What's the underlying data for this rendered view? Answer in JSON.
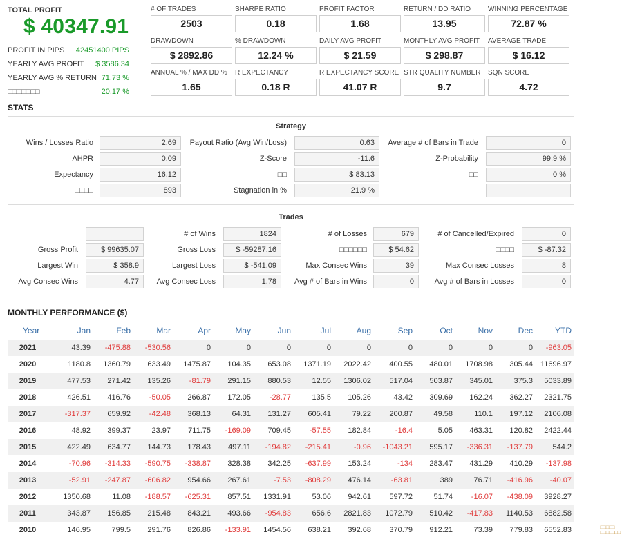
{
  "summary": {
    "title": "TOTAL PROFIT",
    "total_value": "$ 40347.91",
    "rows": [
      {
        "label": "PROFIT IN PIPS",
        "value": "42451400 PIPS"
      },
      {
        "label": "YEARLY AVG PROFIT",
        "value": "$ 3586.34"
      },
      {
        "label": "YEARLY AVG % RETURN",
        "value": "71.73 %"
      },
      {
        "label": "□□□□□□□",
        "value": "20.17 %"
      }
    ]
  },
  "metrics": [
    {
      "label": "# OF TRADES",
      "value": "2503"
    },
    {
      "label": "SHARPE RATIO",
      "value": "0.18"
    },
    {
      "label": "PROFIT FACTOR",
      "value": "1.68"
    },
    {
      "label": "RETURN / DD RATIO",
      "value": "13.95"
    },
    {
      "label": "WINNING PERCENTAGE",
      "value": "72.87 %"
    },
    {
      "label": "DRAWDOWN",
      "value": "$ 2892.86"
    },
    {
      "label": "% DRAWDOWN",
      "value": "12.24 %"
    },
    {
      "label": "DAILY AVG PROFIT",
      "value": "$ 21.59"
    },
    {
      "label": "MONTHLY AVG PROFIT",
      "value": "$ 298.87"
    },
    {
      "label": "AVERAGE TRADE",
      "value": "$ 16.12"
    },
    {
      "label": "ANNUAL % / MAX DD %",
      "value": "1.65"
    },
    {
      "label": "R EXPECTANCY",
      "value": "0.18 R"
    },
    {
      "label": "R EXPECTANCY SCORE",
      "value": "41.07 R"
    },
    {
      "label": "STR QUALITY NUMBER",
      "value": "9.7"
    },
    {
      "label": "SQN SCORE",
      "value": "4.72"
    }
  ],
  "stats": {
    "title": "STATS",
    "strategy_heading": "Strategy",
    "strategy": [
      [
        {
          "label": "Wins / Losses Ratio",
          "value": "2.69"
        },
        {
          "label": "Payout Ratio (Avg Win/Loss)",
          "value": "0.63"
        },
        {
          "label": "Average # of Bars in Trade",
          "value": "0"
        }
      ],
      [
        {
          "label": "AHPR",
          "value": "0.09"
        },
        {
          "label": "Z-Score",
          "value": "-11.6"
        },
        {
          "label": "Z-Probability",
          "value": "99.9 %"
        }
      ],
      [
        {
          "label": "Expectancy",
          "value": "16.12"
        },
        {
          "label": "□□",
          "value": "$ 83.13"
        },
        {
          "label": "□□",
          "value": "0 %"
        }
      ],
      [
        {
          "label": "□□□□",
          "value": "893"
        },
        {
          "label": "Stagnation in %",
          "value": "21.9 %"
        },
        {
          "label": "",
          "value": ""
        }
      ]
    ],
    "trades_heading": "Trades",
    "trades": [
      [
        {
          "label": "",
          "value": ""
        },
        {
          "label": "# of Wins",
          "value": "1824"
        },
        {
          "label": "# of Losses",
          "value": "679"
        },
        {
          "label": "# of Cancelled/Expired",
          "value": "0"
        }
      ],
      [
        {
          "label": "Gross Profit",
          "value": "$ 99635.07"
        },
        {
          "label": "Gross Loss",
          "value": "$ -59287.16"
        },
        {
          "label": "□□□□□□",
          "value": "$ 54.62"
        },
        {
          "label": "□□□□",
          "value": "$ -87.32"
        }
      ],
      [
        {
          "label": "Largest Win",
          "value": "$ 358.9"
        },
        {
          "label": "Largest Loss",
          "value": "$ -541.09"
        },
        {
          "label": "Max Consec Wins",
          "value": "39"
        },
        {
          "label": "Max Consec Losses",
          "value": "8"
        }
      ],
      [
        {
          "label": "Avg Consec Wins",
          "value": "4.77"
        },
        {
          "label": "Avg Consec Loss",
          "value": "1.78"
        },
        {
          "label": "Avg # of Bars in Wins",
          "value": "0"
        },
        {
          "label": "Avg # of Bars in Losses",
          "value": "0"
        }
      ]
    ]
  },
  "monthly": {
    "title": "MONTHLY PERFORMANCE ($)",
    "headers": [
      "Year",
      "Jan",
      "Feb",
      "Mar",
      "Apr",
      "May",
      "Jun",
      "Jul",
      "Aug",
      "Sep",
      "Oct",
      "Nov",
      "Dec",
      "YTD"
    ],
    "rows": [
      [
        "2021",
        "43.39",
        "-475.88",
        "-530.56",
        "0",
        "0",
        "0",
        "0",
        "0",
        "0",
        "0",
        "0",
        "0",
        "-963.05"
      ],
      [
        "2020",
        "1180.8",
        "1360.79",
        "633.49",
        "1475.87",
        "104.35",
        "653.08",
        "1371.19",
        "2022.42",
        "400.55",
        "480.01",
        "1708.98",
        "305.44",
        "11696.97"
      ],
      [
        "2019",
        "477.53",
        "271.42",
        "135.26",
        "-81.79",
        "291.15",
        "880.53",
        "12.55",
        "1306.02",
        "517.04",
        "503.87",
        "345.01",
        "375.3",
        "5033.89"
      ],
      [
        "2018",
        "426.51",
        "416.76",
        "-50.05",
        "266.87",
        "172.05",
        "-28.77",
        "135.5",
        "105.26",
        "43.42",
        "309.69",
        "162.24",
        "362.27",
        "2321.75"
      ],
      [
        "2017",
        "-317.37",
        "659.92",
        "-42.48",
        "368.13",
        "64.31",
        "131.27",
        "605.41",
        "79.22",
        "200.87",
        "49.58",
        "110.1",
        "197.12",
        "2106.08"
      ],
      [
        "2016",
        "48.92",
        "399.37",
        "23.97",
        "711.75",
        "-169.09",
        "709.45",
        "-57.55",
        "182.84",
        "-16.4",
        "5.05",
        "463.31",
        "120.82",
        "2422.44"
      ],
      [
        "2015",
        "422.49",
        "634.77",
        "144.73",
        "178.43",
        "497.11",
        "-194.82",
        "-215.41",
        "-0.96",
        "-1043.21",
        "595.17",
        "-336.31",
        "-137.79",
        "544.2"
      ],
      [
        "2014",
        "-70.96",
        "-314.33",
        "-590.75",
        "-338.87",
        "328.38",
        "342.25",
        "-637.99",
        "153.24",
        "-134",
        "283.47",
        "431.29",
        "410.29",
        "-137.98"
      ],
      [
        "2013",
        "-52.91",
        "-247.87",
        "-606.82",
        "954.66",
        "267.61",
        "-7.53",
        "-808.29",
        "476.14",
        "-63.81",
        "389",
        "76.71",
        "-416.96",
        "-40.07"
      ],
      [
        "2012",
        "1350.68",
        "11.08",
        "-188.57",
        "-625.31",
        "857.51",
        "1331.91",
        "53.06",
        "942.61",
        "597.72",
        "51.74",
        "-16.07",
        "-438.09",
        "3928.27"
      ],
      [
        "2011",
        "343.87",
        "156.85",
        "215.48",
        "843.21",
        "493.66",
        "-954.83",
        "656.6",
        "2821.83",
        "1072.79",
        "510.42",
        "-417.83",
        "1140.53",
        "6882.58"
      ],
      [
        "2010",
        "146.95",
        "799.5",
        "291.76",
        "826.86",
        "-133.91",
        "1454.56",
        "638.21",
        "392.68",
        "370.79",
        "912.21",
        "73.39",
        "779.83",
        "6552.83"
      ]
    ]
  },
  "colors": {
    "positive": "#1a9a2a",
    "negative": "#e03a3a",
    "header_blue": "#3a6fa8"
  }
}
